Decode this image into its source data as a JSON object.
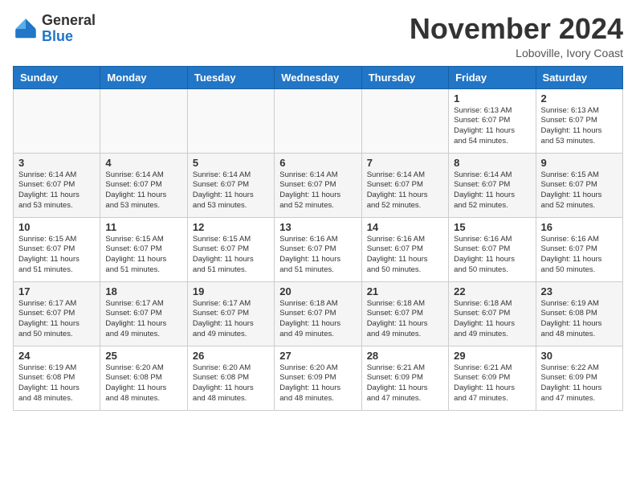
{
  "header": {
    "logo_general": "General",
    "logo_blue": "Blue",
    "month_title": "November 2024",
    "location": "Loboville, Ivory Coast"
  },
  "days_of_week": [
    "Sunday",
    "Monday",
    "Tuesday",
    "Wednesday",
    "Thursday",
    "Friday",
    "Saturday"
  ],
  "weeks": [
    [
      {
        "day": "",
        "info": ""
      },
      {
        "day": "",
        "info": ""
      },
      {
        "day": "",
        "info": ""
      },
      {
        "day": "",
        "info": ""
      },
      {
        "day": "",
        "info": ""
      },
      {
        "day": "1",
        "info": "Sunrise: 6:13 AM\nSunset: 6:07 PM\nDaylight: 11 hours\nand 54 minutes."
      },
      {
        "day": "2",
        "info": "Sunrise: 6:13 AM\nSunset: 6:07 PM\nDaylight: 11 hours\nand 53 minutes."
      }
    ],
    [
      {
        "day": "3",
        "info": "Sunrise: 6:14 AM\nSunset: 6:07 PM\nDaylight: 11 hours\nand 53 minutes."
      },
      {
        "day": "4",
        "info": "Sunrise: 6:14 AM\nSunset: 6:07 PM\nDaylight: 11 hours\nand 53 minutes."
      },
      {
        "day": "5",
        "info": "Sunrise: 6:14 AM\nSunset: 6:07 PM\nDaylight: 11 hours\nand 53 minutes."
      },
      {
        "day": "6",
        "info": "Sunrise: 6:14 AM\nSunset: 6:07 PM\nDaylight: 11 hours\nand 52 minutes."
      },
      {
        "day": "7",
        "info": "Sunrise: 6:14 AM\nSunset: 6:07 PM\nDaylight: 11 hours\nand 52 minutes."
      },
      {
        "day": "8",
        "info": "Sunrise: 6:14 AM\nSunset: 6:07 PM\nDaylight: 11 hours\nand 52 minutes."
      },
      {
        "day": "9",
        "info": "Sunrise: 6:15 AM\nSunset: 6:07 PM\nDaylight: 11 hours\nand 52 minutes."
      }
    ],
    [
      {
        "day": "10",
        "info": "Sunrise: 6:15 AM\nSunset: 6:07 PM\nDaylight: 11 hours\nand 51 minutes."
      },
      {
        "day": "11",
        "info": "Sunrise: 6:15 AM\nSunset: 6:07 PM\nDaylight: 11 hours\nand 51 minutes."
      },
      {
        "day": "12",
        "info": "Sunrise: 6:15 AM\nSunset: 6:07 PM\nDaylight: 11 hours\nand 51 minutes."
      },
      {
        "day": "13",
        "info": "Sunrise: 6:16 AM\nSunset: 6:07 PM\nDaylight: 11 hours\nand 51 minutes."
      },
      {
        "day": "14",
        "info": "Sunrise: 6:16 AM\nSunset: 6:07 PM\nDaylight: 11 hours\nand 50 minutes."
      },
      {
        "day": "15",
        "info": "Sunrise: 6:16 AM\nSunset: 6:07 PM\nDaylight: 11 hours\nand 50 minutes."
      },
      {
        "day": "16",
        "info": "Sunrise: 6:16 AM\nSunset: 6:07 PM\nDaylight: 11 hours\nand 50 minutes."
      }
    ],
    [
      {
        "day": "17",
        "info": "Sunrise: 6:17 AM\nSunset: 6:07 PM\nDaylight: 11 hours\nand 50 minutes."
      },
      {
        "day": "18",
        "info": "Sunrise: 6:17 AM\nSunset: 6:07 PM\nDaylight: 11 hours\nand 49 minutes."
      },
      {
        "day": "19",
        "info": "Sunrise: 6:17 AM\nSunset: 6:07 PM\nDaylight: 11 hours\nand 49 minutes."
      },
      {
        "day": "20",
        "info": "Sunrise: 6:18 AM\nSunset: 6:07 PM\nDaylight: 11 hours\nand 49 minutes."
      },
      {
        "day": "21",
        "info": "Sunrise: 6:18 AM\nSunset: 6:07 PM\nDaylight: 11 hours\nand 49 minutes."
      },
      {
        "day": "22",
        "info": "Sunrise: 6:18 AM\nSunset: 6:07 PM\nDaylight: 11 hours\nand 49 minutes."
      },
      {
        "day": "23",
        "info": "Sunrise: 6:19 AM\nSunset: 6:08 PM\nDaylight: 11 hours\nand 48 minutes."
      }
    ],
    [
      {
        "day": "24",
        "info": "Sunrise: 6:19 AM\nSunset: 6:08 PM\nDaylight: 11 hours\nand 48 minutes."
      },
      {
        "day": "25",
        "info": "Sunrise: 6:20 AM\nSunset: 6:08 PM\nDaylight: 11 hours\nand 48 minutes."
      },
      {
        "day": "26",
        "info": "Sunrise: 6:20 AM\nSunset: 6:08 PM\nDaylight: 11 hours\nand 48 minutes."
      },
      {
        "day": "27",
        "info": "Sunrise: 6:20 AM\nSunset: 6:09 PM\nDaylight: 11 hours\nand 48 minutes."
      },
      {
        "day": "28",
        "info": "Sunrise: 6:21 AM\nSunset: 6:09 PM\nDaylight: 11 hours\nand 47 minutes."
      },
      {
        "day": "29",
        "info": "Sunrise: 6:21 AM\nSunset: 6:09 PM\nDaylight: 11 hours\nand 47 minutes."
      },
      {
        "day": "30",
        "info": "Sunrise: 6:22 AM\nSunset: 6:09 PM\nDaylight: 11 hours\nand 47 minutes."
      }
    ]
  ]
}
